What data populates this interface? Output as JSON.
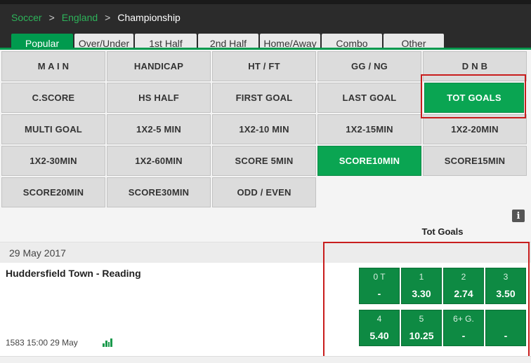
{
  "breadcrumb": {
    "sport": "Soccer",
    "country": "England",
    "league": "Championship",
    "separator": ">"
  },
  "tabs": [
    "Popular",
    "Over/Under",
    "1st Half",
    "2nd Half",
    "Home/Away",
    "Combo",
    "Other"
  ],
  "markets": [
    [
      "M A I N",
      "HANDICAP",
      "HT / FT",
      "GG / NG",
      "D N B"
    ],
    [
      "C.SCORE",
      "HS HALF",
      "FIRST GOAL",
      "LAST GOAL",
      "TOT GOALS"
    ],
    [
      "MULTI GOAL",
      "1X2-5 MIN",
      "1X2-10 MIN",
      "1X2-15MIN",
      "1X2-20MIN"
    ],
    [
      "1X2-30MIN",
      "1X2-60MIN",
      "SCORE 5MIN",
      "SCORE10MIN",
      "SCORE15MIN"
    ],
    [
      "SCORE20MIN",
      "SCORE30MIN",
      "ODD / EVEN"
    ]
  ],
  "info_label": "i",
  "column_header": "Tot Goals",
  "date": "29 May 2017",
  "event": {
    "teams": "Huddersfield Town - Reading",
    "meta": "1583 15:00  29 May",
    "odds": [
      {
        "label": "0 T",
        "value": "-"
      },
      {
        "label": "1",
        "value": "3.30"
      },
      {
        "label": "2",
        "value": "2.74"
      },
      {
        "label": "3",
        "value": "3.50"
      },
      {
        "label": "4",
        "value": "5.40"
      },
      {
        "label": "5",
        "value": "10.25"
      },
      {
        "label": "6+ G.",
        "value": "-"
      },
      {
        "label": "",
        "value": "-"
      }
    ]
  },
  "colors": {
    "accent": "#009a4e",
    "selected": "#0aa552",
    "odds_bg": "#0e8a43",
    "highlight": "#c81d1d"
  }
}
